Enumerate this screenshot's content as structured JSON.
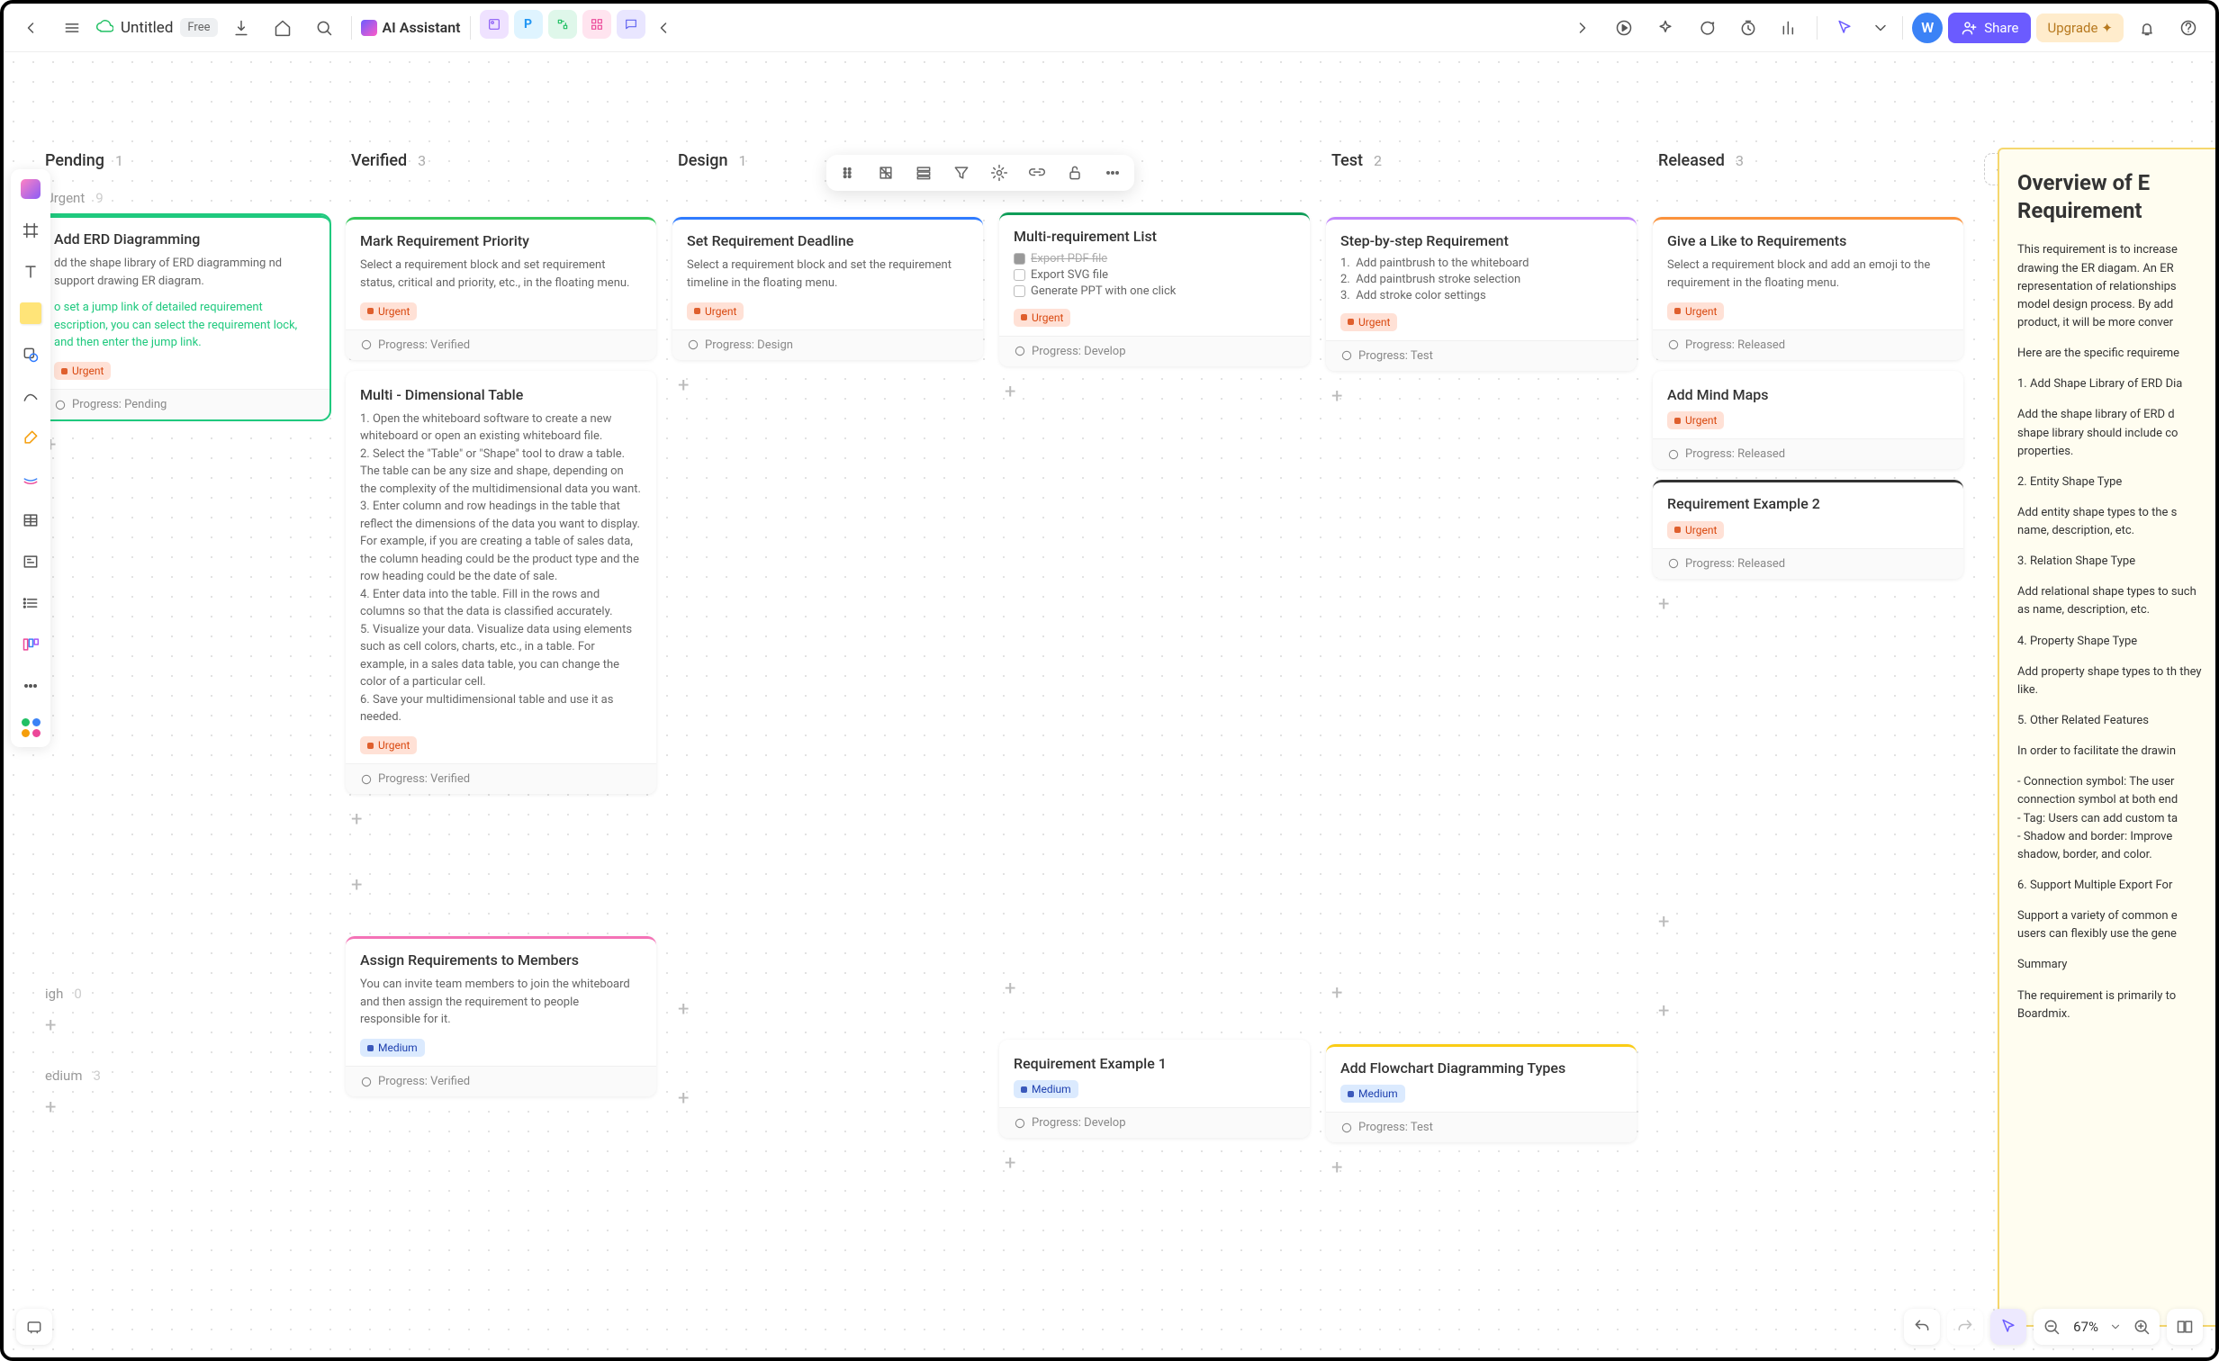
{
  "header": {
    "title": "Untitled",
    "plan_badge": "Free",
    "ai_label": "AI Assistant",
    "avatar_initial": "W",
    "share_label": "Share",
    "upgrade_label": "Upgrade",
    "zoom": "67%"
  },
  "swimlanes": {
    "urgent": {
      "label": "Urgent",
      "count": "9"
    },
    "high": {
      "label": "igh",
      "count": "0"
    },
    "medium": {
      "label": "edium",
      "count": "3"
    }
  },
  "columns": [
    {
      "title": "Pending",
      "count": "1"
    },
    {
      "title": "Verified",
      "count": "3"
    },
    {
      "title": "Design",
      "count": "1"
    },
    {
      "title": "",
      "count": ""
    },
    {
      "title": "Test",
      "count": "2"
    },
    {
      "title": "Released",
      "count": "3"
    }
  ],
  "cards": {
    "erd": {
      "title": "Add ERD Diagramming",
      "desc": "dd the shape library of ERD diagramming nd support drawing ER diagram.",
      "link": "o set a jump link of detailed requirement escription, you can select the requirement lock, and then enter the jump link.",
      "tag": "Urgent",
      "progress": "Progress: Pending"
    },
    "mark": {
      "title": "Mark Requirement Priority",
      "desc": "Select a requirement block and set requirement status, critical and priority, etc., in the floating menu.",
      "tag": "Urgent",
      "progress": "Progress: Verified"
    },
    "multidim": {
      "title": "Multi - Dimensional Table",
      "desc": "1. Open the whiteboard software to create a new whiteboard or open an existing whiteboard file.\n2. Select the \"Table\" or \"Shape\" tool to draw a table. The table can be any size and shape, depending on the complexity of the multidimensional data you want.\n3. Enter column and row headings in the table that reflect the dimensions of the data you want to display. For example, if you are creating a table of sales data, the column heading could be the product type and the row heading could be the date of sale.\n4. Enter data into the table. Fill in the rows and columns so that the data is classified accurately.\n5. Visualize your data. Visualize data using elements such as cell colors, charts, etc., in a table. For example, in a sales data table, you can change the color of a particular cell.\n6. Save your multidimensional table and use it as needed.",
      "tag": "Urgent",
      "progress": "Progress: Verified"
    },
    "deadline": {
      "title": "Set Requirement Deadline",
      "desc": "Select a requirement block and set the requirement timeline in the floating menu.",
      "tag": "Urgent",
      "progress": "Progress: Design"
    },
    "multireq": {
      "title": "Multi-requirement List",
      "items": [
        "Export PDF file",
        "Export SVG file",
        "Generate PPT with one click"
      ],
      "tag": "Urgent",
      "progress": "Progress: Develop"
    },
    "step": {
      "title": "Step-by-step Requirement",
      "items": [
        "Add paintbrush to the whiteboard",
        "Add paintbrush stroke selection",
        "Add stroke color settings"
      ],
      "tag": "Urgent",
      "progress": "Progress: Test"
    },
    "like": {
      "title": "Give a Like to Requirements",
      "desc": "Select a requirement block and add an emoji to the requirement in the floating menu.",
      "tag": "Urgent",
      "progress": "Progress: Released"
    },
    "mindmap": {
      "title": "Add Mind Maps",
      "tag": "Urgent",
      "progress": "Progress: Released"
    },
    "ex2": {
      "title": "Requirement Example 2",
      "tag": "Urgent",
      "progress": "Progress: Released"
    },
    "assign": {
      "title": "Assign Requirements to Members",
      "desc": "You can invite team members to join the whiteboard and then assign the requirement to people responsible for it.",
      "tag": "Medium",
      "progress": "Progress: Verified"
    },
    "ex1": {
      "title": "Requirement Example 1",
      "tag": "Medium",
      "progress": "Progress: Develop"
    },
    "flowchart": {
      "title": "Add Flowchart Diagramming Types",
      "tag": "Medium",
      "progress": "Progress: Test"
    }
  },
  "detail": {
    "title": "Overview of E Requirement",
    "p1": "This requirement is to increase drawing the ER diagam. An ER representation of relationships model design process. By add product, it will be more conver",
    "p2": "Here are the specific requireme",
    "p3": "1. Add Shape Library of ERD Dia",
    "p4": "Add the shape library of ERD d shape library should include co properties.",
    "p5": "2. Entity Shape Type",
    "p6": "Add entity shape types to the s name, description, etc.",
    "p7": "3. Relation Shape Type",
    "p8": "Add relational shape types to such as name, description, etc.",
    "p9": "4. Property Shape Type",
    "p10": "Add property shape types to th they like.",
    "p11": "5. Other Related Features",
    "p12": "In order to facilitate the drawin",
    "p13": "- Connection symbol: The user connection symbol at both end\n- Tag: Users can add custom ta\n- Shadow and border: Improve shadow, border, and color.",
    "p14": "6. Support Multiple Export For",
    "p15": "Support a variety of common e users can flexibly use the gene",
    "p16": "Summary",
    "p17": "The requirement is primarily to Boardmix."
  }
}
